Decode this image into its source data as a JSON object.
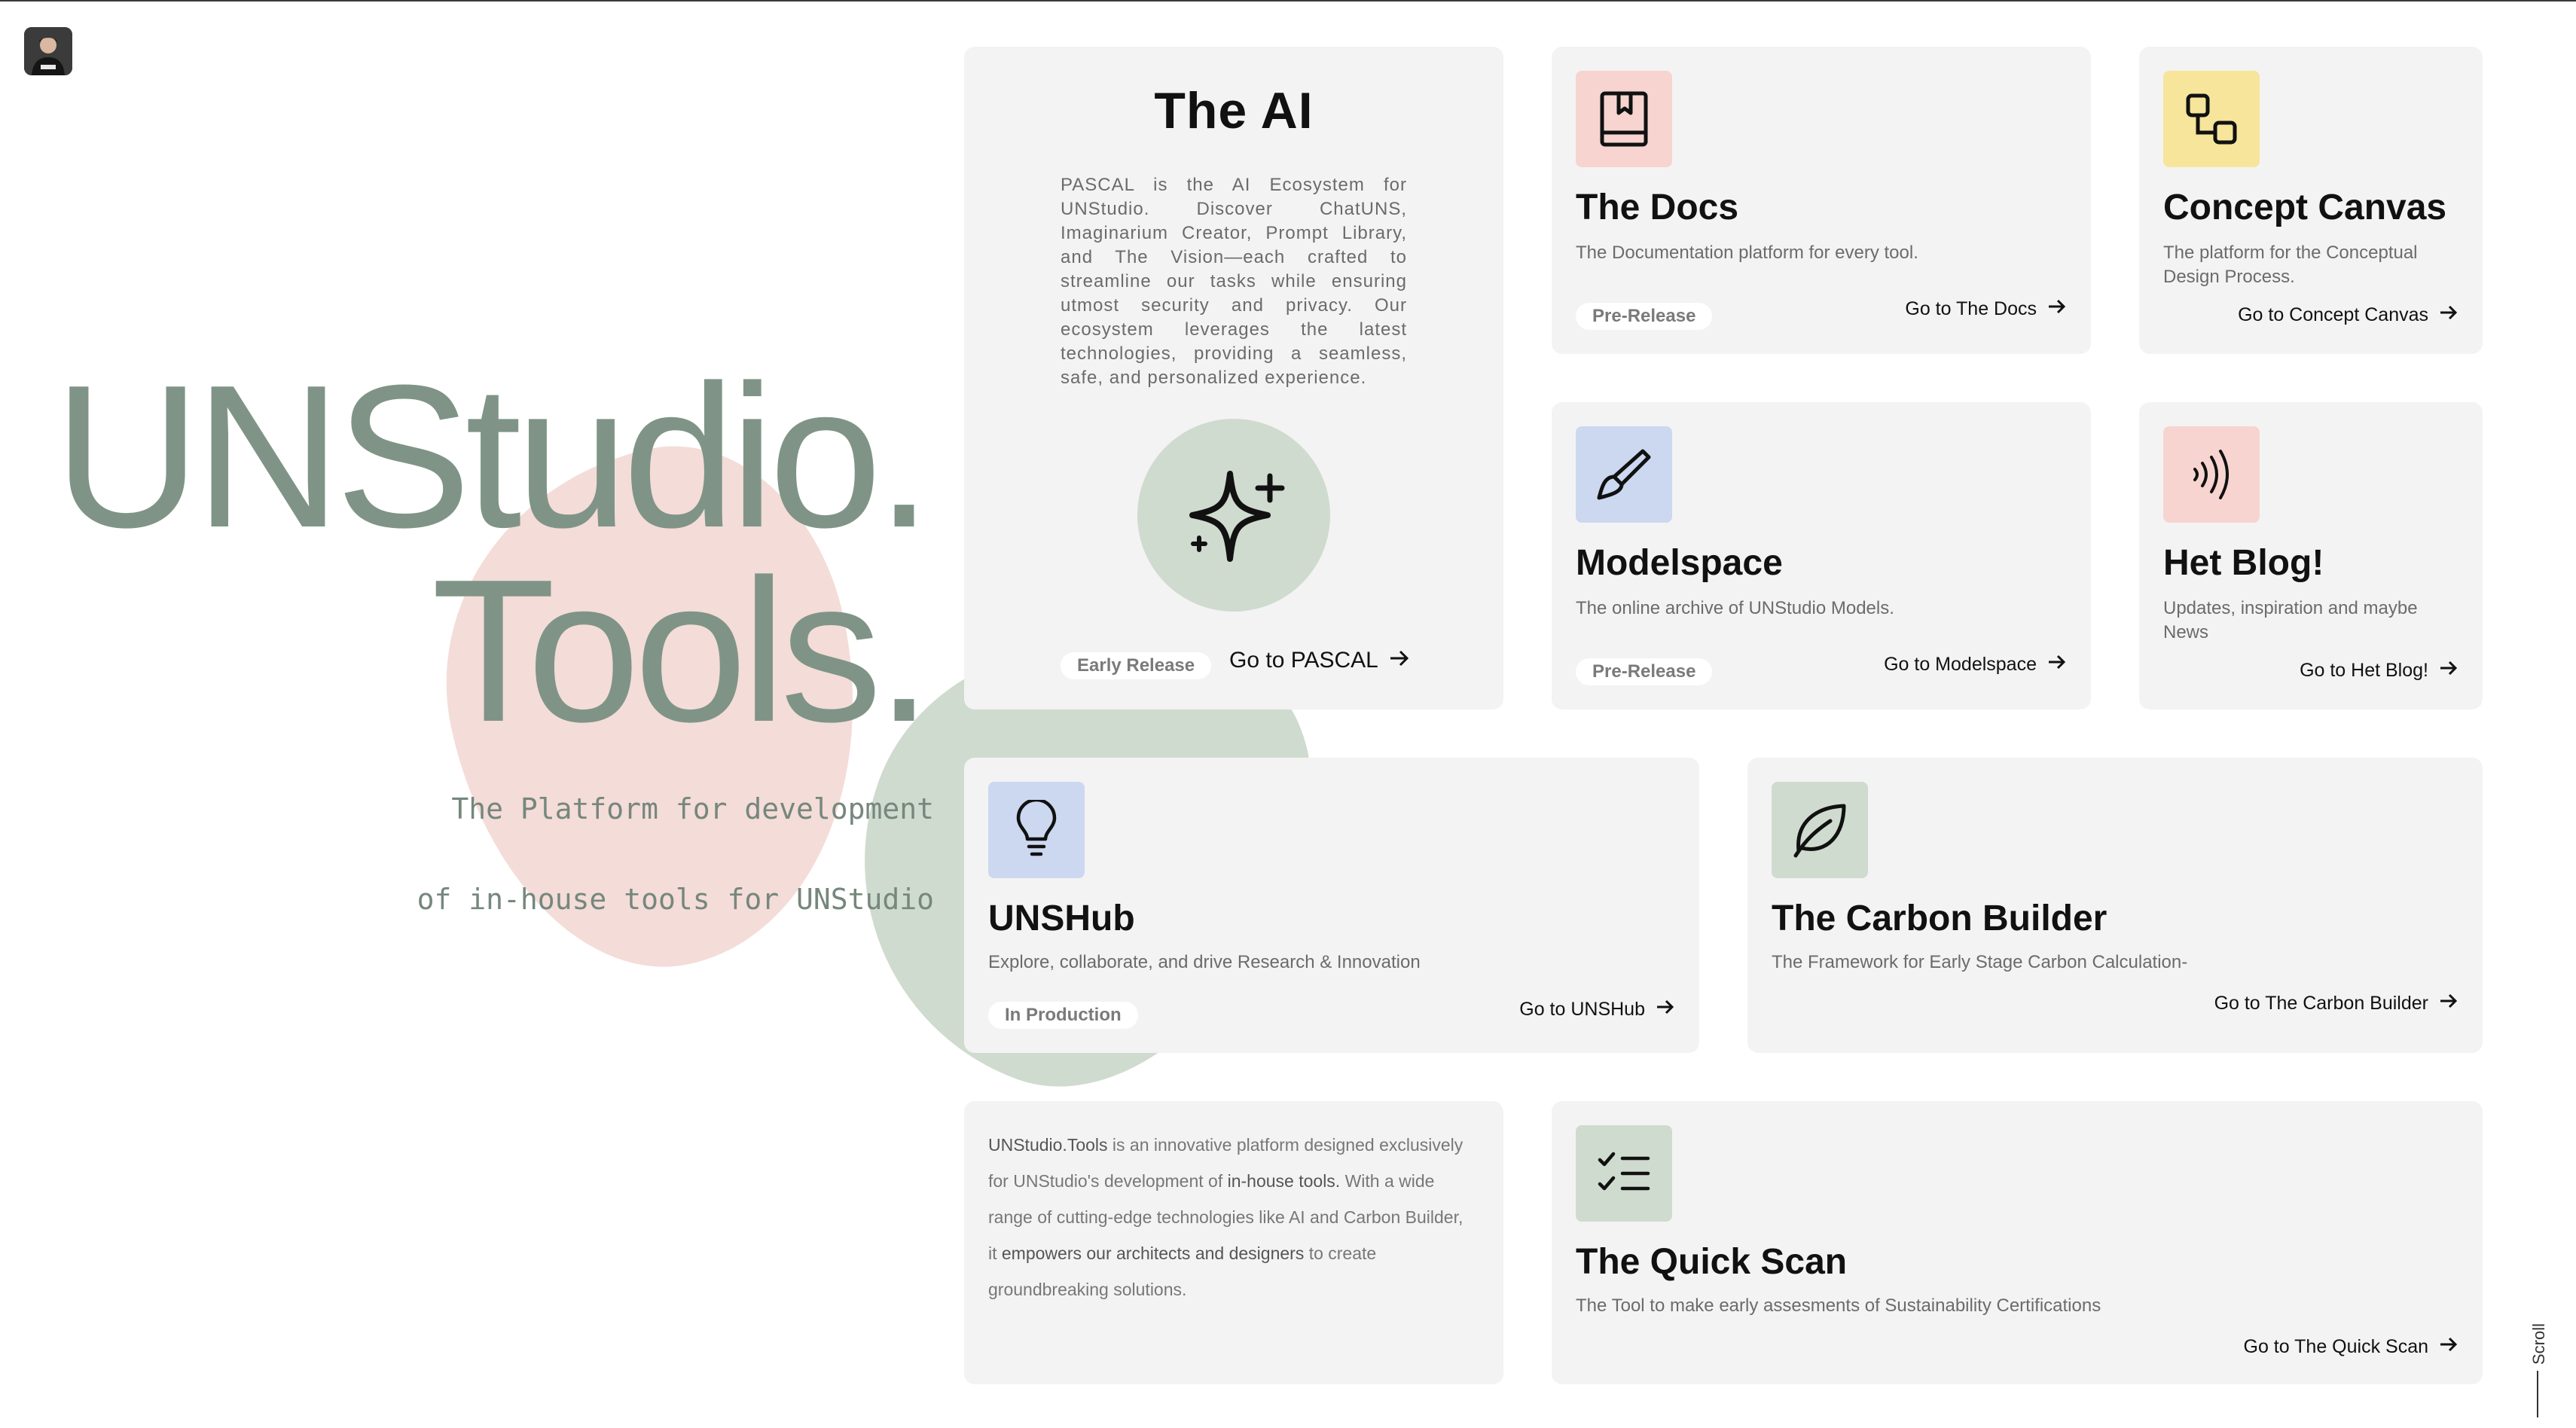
{
  "hero": {
    "title_line1": "UNStudio.",
    "title_line2": "Tools.",
    "subtitle_line1": "The Platform for development",
    "subtitle_line2": "of in-house tools for UNStudio"
  },
  "ai_card": {
    "title": "The AI",
    "description": "PASCAL is the AI Ecosystem for UNStudio. Discover ChatUNS, Imaginarium Creator, Prompt Library, and The Vision—each crafted to streamline our tasks while ensuring utmost security and privacy. Our ecosystem leverages the latest technologies, providing a seamless, safe, and personalized experience.",
    "icon": "sparkle-icon",
    "badge": "Early Release",
    "link": "Go to PASCAL"
  },
  "tools": {
    "docs": {
      "title": "The Docs",
      "description": "The Documentation platform for every tool.",
      "badge": "Pre-Release",
      "link": "Go to The Docs",
      "icon": "book-icon",
      "color": "#f7d4d0"
    },
    "concept": {
      "title": "Concept Canvas",
      "description": "The platform for the Conceptual Design Process.",
      "link": "Go to Concept Canvas",
      "icon": "connected-squares-icon",
      "color": "#f6e59a"
    },
    "modelspace": {
      "title": "Modelspace",
      "description": "The online archive of UNStudio Models.",
      "badge": "Pre-Release",
      "link": "Go to Modelspace",
      "icon": "brush-icon",
      "color": "#ccd8f0"
    },
    "blog": {
      "title": "Het Blog!",
      "description": "Updates, inspiration and maybe News",
      "link": "Go to Het Blog!",
      "icon": "broadcast-icon",
      "color": "#f7d4d0"
    },
    "unshub": {
      "title": "UNSHub",
      "description": "Explore, collaborate, and drive Research & Innovation",
      "badge": "In Production",
      "link": "Go to UNSHub",
      "icon": "lightbulb-icon",
      "color": "#ccd8f0"
    },
    "carbon": {
      "title": "The Carbon Builder",
      "description": "The Framework for Early Stage Carbon Calculation-",
      "link": "Go to The Carbon Builder",
      "icon": "leaf-icon",
      "color": "#cfdbcf"
    },
    "quickscan": {
      "title": "The Quick Scan",
      "description": "The Tool to make early assesments of Sustainability Certifications",
      "link": "Go to The Quick Scan",
      "icon": "checklist-icon",
      "color": "#cfdbcf"
    }
  },
  "about": {
    "part1": "UNStudio.Tools",
    "part2": " is an innovative platform designed exclusively for UNStudio's development of ",
    "part3": "in-house tools.",
    "part4": " With a wide range of cutting-edge technologies like AI and Carbon Builder, it ",
    "part5": "empowers our architects and designers",
    "part6": " to create groundbreaking solutions."
  },
  "scroll_label": "Scroll",
  "colors": {
    "accent_green": "#7f9487",
    "card_bg": "#f3f3f3",
    "blob_pink": "#f4dcd8",
    "blob_green": "#cfdbcf"
  }
}
